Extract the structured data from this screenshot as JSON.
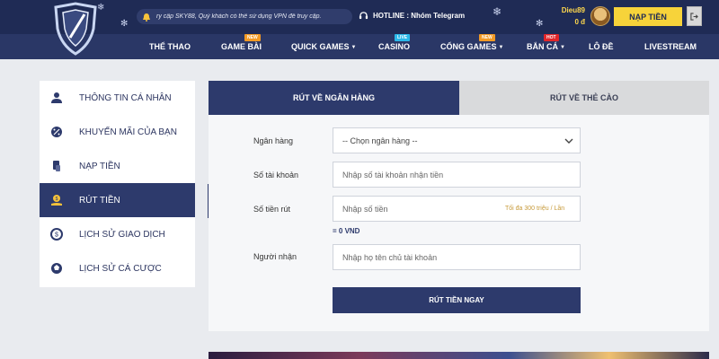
{
  "header": {
    "notice_text": "ry cập SKY88, Quý khách có thể sử dụng VPN để truy cập.",
    "hotline_text": "HOTLINE : Nhóm Telegram",
    "username": "Dieu89",
    "balance": "0 đ",
    "deposit_button": "NẠP TIỀN"
  },
  "nav": {
    "items": [
      {
        "label": "THỂ THAO",
        "badge": "",
        "dropdown": false
      },
      {
        "label": "GAME BÀI",
        "badge": "NEW",
        "dropdown": false
      },
      {
        "label": "QUICK GAMES",
        "badge": "",
        "dropdown": true
      },
      {
        "label": "CASINO",
        "badge": "LIVE",
        "dropdown": false
      },
      {
        "label": "CỔNG GAMES",
        "badge": "NEW",
        "dropdown": true
      },
      {
        "label": "BẮN CÁ",
        "badge": "HOT",
        "dropdown": true
      },
      {
        "label": "LÔ ĐỀ",
        "badge": "",
        "dropdown": false
      },
      {
        "label": "LIVESTREAM",
        "badge": "",
        "dropdown": false
      }
    ],
    "caret": "▼"
  },
  "sidebar": {
    "items": [
      {
        "label": "THÔNG TIN CÁ NHÂN",
        "icon": "user-icon",
        "active": false
      },
      {
        "label": "KHUYẾN MÃI CỦA BẠN",
        "icon": "promo-icon",
        "active": false
      },
      {
        "label": "NẠP TIỀN",
        "icon": "deposit-icon",
        "active": false
      },
      {
        "label": "RÚT TIỀN",
        "icon": "withdraw-icon",
        "active": true
      },
      {
        "label": "LỊCH SỬ GIAO DỊCH",
        "icon": "transaction-history-icon",
        "active": false
      },
      {
        "label": "LỊCH SỬ CÁ CƯỢC",
        "icon": "bet-history-icon",
        "active": false
      }
    ]
  },
  "tabs": {
    "bank": "RÚT VỀ NGÂN HÀNG",
    "card": "RÚT VỀ THẺ CÀO"
  },
  "form": {
    "bank_label": "Ngân hàng",
    "bank_select_value": "-- Chọn ngân hàng --",
    "account_label": "Số tài khoản",
    "account_placeholder": "Nhập số tài khoản nhận tiền",
    "amount_label": "Số tiền rút",
    "amount_placeholder": "Nhập số tiền",
    "amount_hint": "Tối đa 300 triệu / Lần",
    "amount_converted": "= 0 VND",
    "recipient_label": "Người nhận",
    "recipient_placeholder": "Nhập họ tên chủ tài khoản",
    "submit_button": "RÚT TIỀN NGAY"
  },
  "colors": {
    "header_bg": "#2a3766",
    "accent_navy": "#2d3a6c",
    "deposit_yellow": "#f7d33a",
    "badge_new": "#f29a25",
    "badge_live": "#2bb8e9",
    "badge_hot": "#e2262a"
  }
}
